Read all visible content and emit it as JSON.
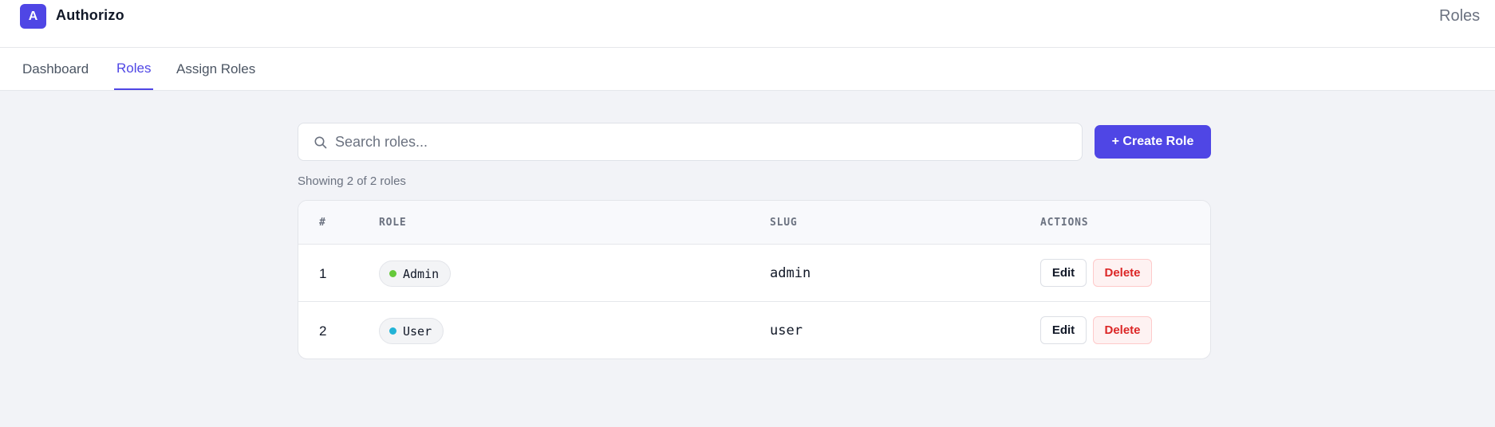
{
  "app": {
    "logo_letter": "A",
    "brand": "Authorizo",
    "page_title": "Roles",
    "accent_color": "#4f46e5"
  },
  "nav": {
    "tabs": [
      {
        "label": "Dashboard",
        "active": false
      },
      {
        "label": "Roles",
        "active": true
      },
      {
        "label": "Assign Roles",
        "active": false
      }
    ]
  },
  "search": {
    "placeholder": "Search roles...",
    "value": ""
  },
  "toolbar": {
    "create_label": "+ Create Role"
  },
  "summary": {
    "showing_text": "Showing 2 of 2 roles"
  },
  "table": {
    "headers": {
      "num": "#",
      "role": "ROLE",
      "slug": "SLUG",
      "actions": "ACTIONS"
    },
    "rows": [
      {
        "num": "1",
        "role": "Admin",
        "dot_color": "#65c93a",
        "slug": "admin",
        "edit": "Edit",
        "delete": "Delete"
      },
      {
        "num": "2",
        "role": "User",
        "dot_color": "#22b3d6",
        "slug": "user",
        "edit": "Edit",
        "delete": "Delete"
      }
    ]
  },
  "icons": {
    "search": "search-icon"
  }
}
